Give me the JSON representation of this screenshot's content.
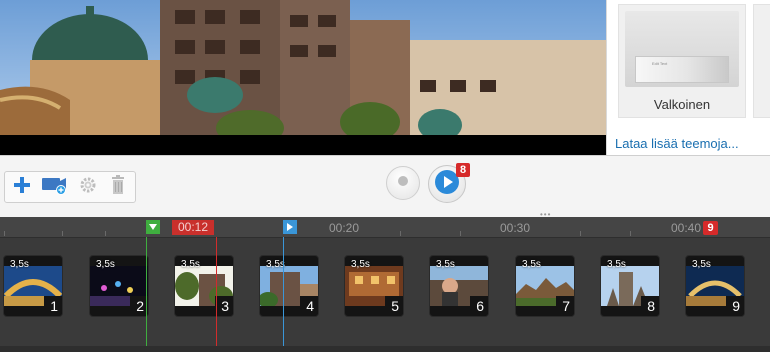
{
  "theme_panel": {
    "theme_name": "Valkoinen",
    "thumb_caption": "Edit Text",
    "more_themes_link": "Lataa lisää teemoja..."
  },
  "toolbar": {
    "add_icon": "plus-icon",
    "add_media_icon": "add-media-icon",
    "settings_icon": "gear-icon",
    "delete_icon": "trash-icon"
  },
  "transport": {
    "record_icon": "record-icon",
    "play_icon": "play-icon",
    "play_badge": "8"
  },
  "timeline": {
    "current_time": "00:12",
    "ruler_labels": [
      "00:20",
      "00:30",
      "00:40"
    ],
    "ruler_badge": "9",
    "clips": [
      {
        "duration": "3,5s",
        "number": "1"
      },
      {
        "duration": "3,5s",
        "number": "2"
      },
      {
        "duration": "3,5s",
        "number": "3"
      },
      {
        "duration": "3,5s",
        "number": "4"
      },
      {
        "duration": "3,5s",
        "number": "5"
      },
      {
        "duration": "3,5s",
        "number": "6"
      },
      {
        "duration": "3,5s",
        "number": "7"
      },
      {
        "duration": "3,5s",
        "number": "8"
      },
      {
        "duration": "3,5s",
        "number": "9"
      }
    ]
  },
  "colors": {
    "accent_red": "#d62a2a",
    "marker_green": "#3fae3f",
    "marker_blue": "#3a96d8",
    "link_blue": "#1a6fb0"
  }
}
